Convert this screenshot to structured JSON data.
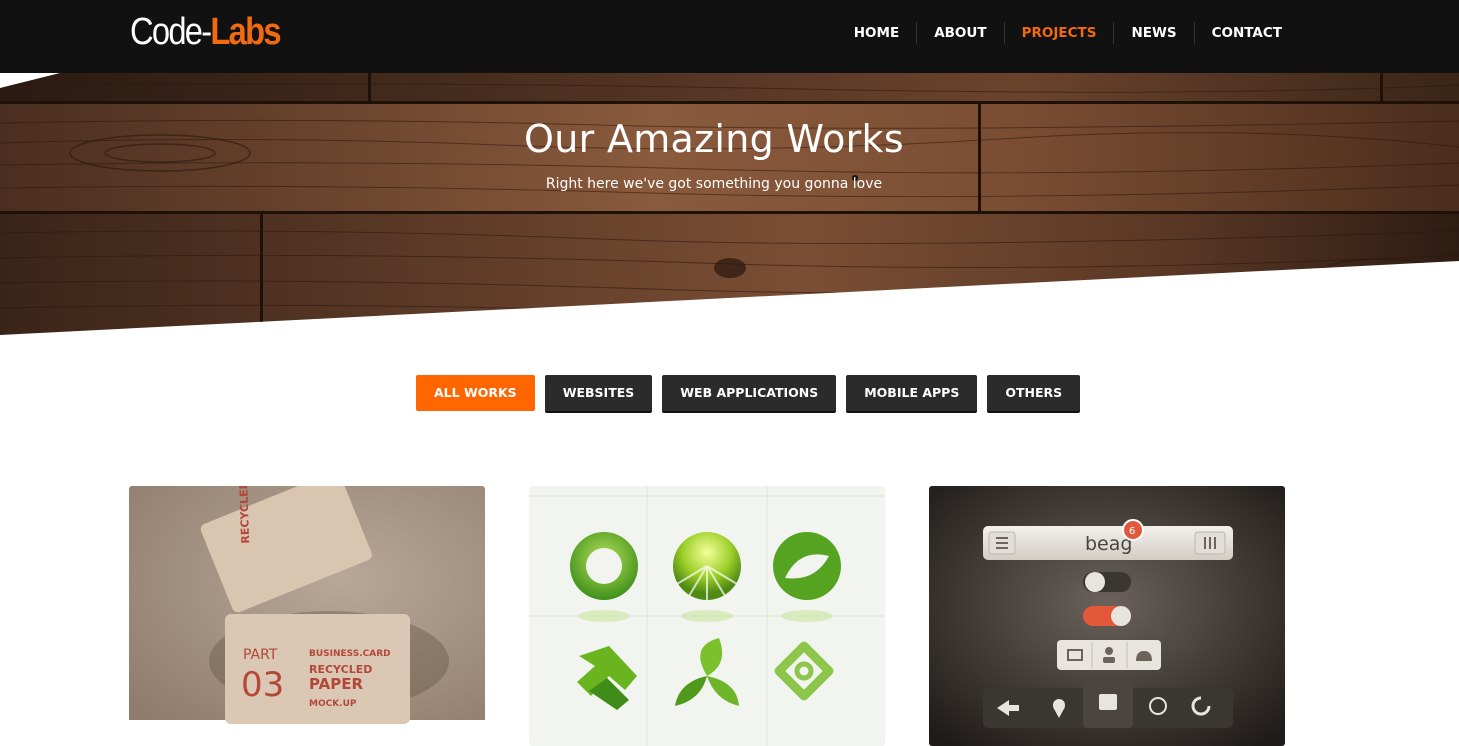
{
  "brand": {
    "logo_part1": "Code-",
    "logo_part2": "Labs"
  },
  "nav": {
    "items": [
      {
        "label": "HOME",
        "active": false
      },
      {
        "label": "ABOUT",
        "active": false
      },
      {
        "label": "PROJECTS",
        "active": true
      },
      {
        "label": "NEWS",
        "active": false
      },
      {
        "label": "CONTACT",
        "active": false
      }
    ]
  },
  "hero": {
    "title": "Our Amazing Works",
    "subtitle": "Right here we've got something you gonna love"
  },
  "filters": {
    "items": [
      {
        "label": "ALL WORKS",
        "active": true
      },
      {
        "label": "WEBSITES",
        "active": false
      },
      {
        "label": "WEB APPLICATIONS",
        "active": false
      },
      {
        "label": "MOBILE APPS",
        "active": false
      },
      {
        "label": "OTHERS",
        "active": false
      }
    ]
  },
  "portfolio": {
    "card1": {
      "card_text_1": "RECYCLED PAPER",
      "card_text_2": "PART",
      "card_text_3": "03",
      "card_text_4": "BUSINESS.CARD",
      "card_text_5": "RECYCLED",
      "card_text_6": "PAPER",
      "card_text_7": "MOCK.UP"
    },
    "card3": {
      "app_name": "beag",
      "badge_count": "6"
    }
  },
  "colors": {
    "accent": "#ff6600",
    "nav_bg": "#111111",
    "button_dark": "#2b2b2b"
  }
}
